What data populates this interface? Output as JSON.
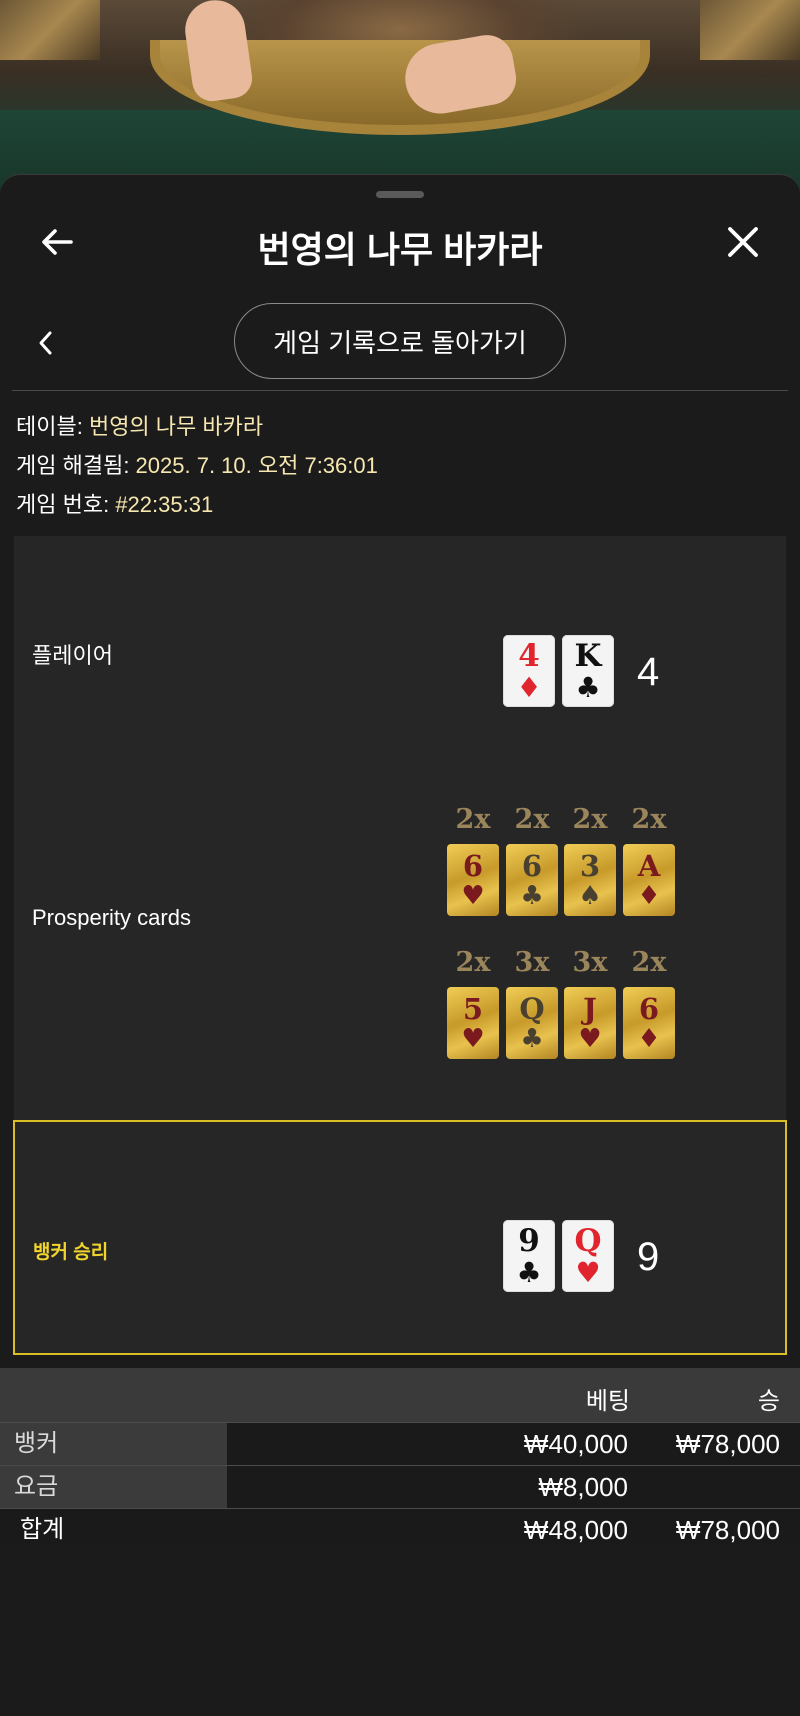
{
  "sheet": {
    "title": "번영의 나무 바카라",
    "return_label": "게임 기록으로 돌아가기"
  },
  "info": {
    "table_label": "테이블: ",
    "table_value": "번영의 나무 바카라",
    "resolved_label": "게임 해결됨: ",
    "resolved_value": "2025. 7. 10. 오전 7:36:01",
    "game_no_label": "게임 번호: ",
    "game_no_value": "#22:35:31"
  },
  "player": {
    "label": "플레이어",
    "cards": [
      {
        "rank": "4",
        "suit": "♦"
      },
      {
        "rank": "K",
        "suit": "♣"
      }
    ],
    "score": "4"
  },
  "prosperity": {
    "label": "Prosperity cards",
    "rows": [
      [
        {
          "mult": "2x",
          "rank": "6",
          "suit": "♥"
        },
        {
          "mult": "2x",
          "rank": "6",
          "suit": "♣"
        },
        {
          "mult": "2x",
          "rank": "3",
          "suit": "♠"
        },
        {
          "mult": "2x",
          "rank": "A",
          "suit": "♦"
        }
      ],
      [
        {
          "mult": "2x",
          "rank": "5",
          "suit": "♥"
        },
        {
          "mult": "3x",
          "rank": "Q",
          "suit": "♣"
        },
        {
          "mult": "3x",
          "rank": "J",
          "suit": "♥"
        },
        {
          "mult": "2x",
          "rank": "6",
          "suit": "♦"
        }
      ]
    ]
  },
  "banker": {
    "label": "뱅커 승리",
    "cards": [
      {
        "rank": "9",
        "suit": "♣"
      },
      {
        "rank": "Q",
        "suit": "♥"
      }
    ],
    "score": "9"
  },
  "bets_table": {
    "col_bet": "베팅",
    "col_win": "승",
    "rows": [
      {
        "name": "뱅커",
        "bet": "₩40,000",
        "win": "₩78,000"
      },
      {
        "name": "요금",
        "bet": "₩8,000",
        "win": ""
      }
    ],
    "total": {
      "name": "합계",
      "bet": "₩48,000",
      "win": "₩78,000"
    }
  },
  "icons": {
    "back": "arrow-left-icon",
    "close": "close-icon",
    "chevron": "chevron-left-icon"
  },
  "colors": {
    "accent_gold": "#d8bd23",
    "info_value": "#f7e7b0",
    "red_suit": "#e0252f"
  }
}
